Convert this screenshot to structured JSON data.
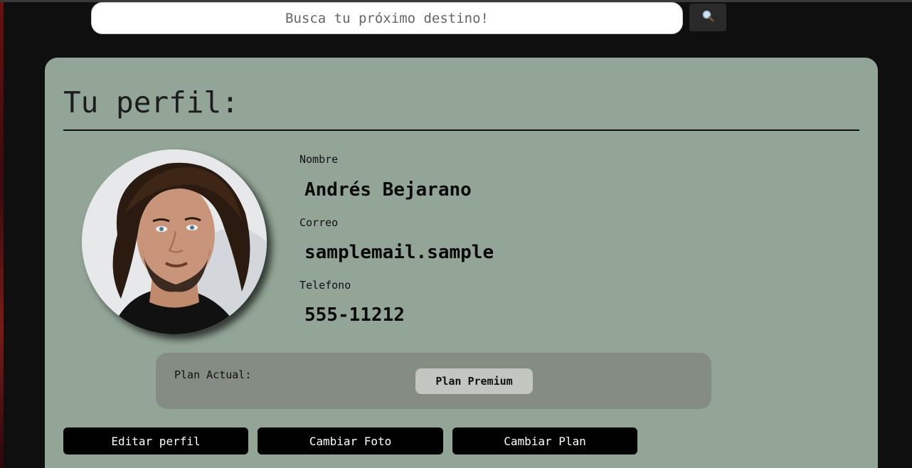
{
  "search": {
    "placeholder": "Busca tu próximo destino!",
    "button_icon": "search-icon"
  },
  "profile": {
    "title": "Tu perfil:",
    "fields": [
      {
        "label": "Nombre",
        "value": "Andrés Bejarano"
      },
      {
        "label": "Correo",
        "value": "samplemail.sample"
      },
      {
        "label": "Telefono",
        "value": "555-11212"
      }
    ],
    "avatar_icon": "profile-photo"
  },
  "plan": {
    "label": "Plan Actual:",
    "value": "Plan Premium"
  },
  "actions": {
    "edit_label": "Editar perfil",
    "photo_label": "Cambiar Foto",
    "plan_label": "Cambiar Plan"
  },
  "colors": {
    "page_background": "#0f0f0f",
    "card_background": "#93a596",
    "plan_box_background": "#858c83",
    "plan_badge_background": "#c3c5c1",
    "button_background": "#000000"
  }
}
